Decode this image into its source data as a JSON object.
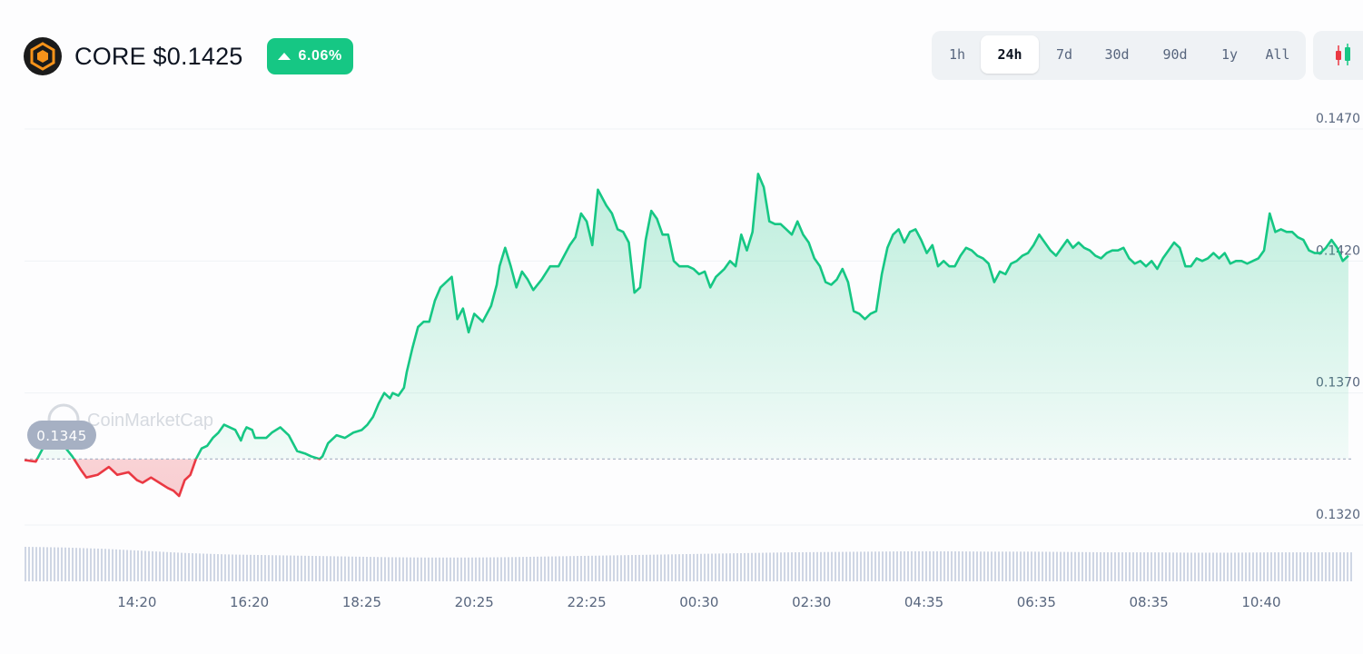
{
  "header": {
    "title": "CORE $0.1425",
    "change_pct": "6.06%",
    "change_direction": "up",
    "logo_icon": "core-logo-icon"
  },
  "range_tabs": [
    {
      "label": "1h",
      "active": false
    },
    {
      "label": "24h",
      "active": true
    },
    {
      "label": "7d",
      "active": false
    },
    {
      "label": "30d",
      "active": false
    },
    {
      "label": "90d",
      "active": false
    },
    {
      "label": "1y",
      "active": false
    },
    {
      "label": "All",
      "active": false
    }
  ],
  "chart_type_toggle_icon": "candlestick-icon",
  "watermark": "CoinMarketCap",
  "colors": {
    "up": "#16c784",
    "down": "#ea3943",
    "accent_logo": "#f7931a",
    "grid": "#eff2f5",
    "volume": "#cfd6e4",
    "open_badge": "#a6b0c3"
  },
  "chart_data": {
    "type": "line",
    "title": "",
    "xlabel": "",
    "ylabel": "",
    "open_price": 0.1345,
    "open_price_label": "0.1345",
    "ylim": [
      0.13045,
      0.14765
    ],
    "y_ticks": [
      {
        "value": 0.132,
        "label": "0.1320"
      },
      {
        "value": 0.137,
        "label": "0.1370"
      },
      {
        "value": 0.142,
        "label": "0.1420"
      },
      {
        "value": 0.147,
        "label": "0.1470"
      }
    ],
    "x_ticks": [
      "14:20",
      "16:20",
      "18:25",
      "20:25",
      "22:25",
      "00:30",
      "02:30",
      "04:35",
      "06:35",
      "08:35",
      "10:40"
    ],
    "x_range": [
      -2.0,
      21.6
    ],
    "x_tick_positions": [
      0,
      2,
      4,
      6,
      8,
      10,
      12,
      14,
      16,
      18,
      20
    ],
    "series": [
      {
        "values": [
          [
            -2.0,
            0.13446
          ],
          [
            -1.8,
            0.1344
          ],
          [
            -1.7,
            0.1348
          ],
          [
            -1.6,
            0.1352
          ],
          [
            -1.45,
            0.1349
          ],
          [
            -1.3,
            0.135
          ],
          [
            -1.15,
            0.1346
          ],
          [
            -1.0,
            0.1341
          ],
          [
            -0.9,
            0.1338
          ],
          [
            -0.7,
            0.1339
          ],
          [
            -0.5,
            0.1342
          ],
          [
            -0.35,
            0.1339
          ],
          [
            -0.15,
            0.134
          ],
          [
            0.0,
            0.1337
          ],
          [
            0.1,
            0.1336
          ],
          [
            0.25,
            0.1338
          ],
          [
            0.4,
            0.1336
          ],
          [
            0.55,
            0.1334
          ],
          [
            0.65,
            0.1333
          ],
          [
            0.75,
            0.1331
          ],
          [
            0.85,
            0.1337
          ],
          [
            0.95,
            0.1339
          ],
          [
            1.05,
            0.1345
          ],
          [
            1.15,
            0.1349
          ],
          [
            1.25,
            0.135
          ],
          [
            1.35,
            0.1353
          ],
          [
            1.45,
            0.1355
          ],
          [
            1.55,
            0.1358
          ],
          [
            1.65,
            0.1357
          ],
          [
            1.75,
            0.1356
          ],
          [
            1.85,
            0.1352
          ],
          [
            1.9,
            0.1355
          ],
          [
            1.95,
            0.1357
          ],
          [
            2.05,
            0.1356
          ],
          [
            2.1,
            0.1353
          ],
          [
            2.2,
            0.1353
          ],
          [
            2.3,
            0.1353
          ],
          [
            2.4,
            0.1355
          ],
          [
            2.55,
            0.1357
          ],
          [
            2.7,
            0.1354
          ],
          [
            2.85,
            0.1348
          ],
          [
            3.0,
            0.1347
          ],
          [
            3.1,
            0.1346
          ],
          [
            3.25,
            0.1345
          ],
          [
            3.3,
            0.1346
          ],
          [
            3.4,
            0.1351
          ],
          [
            3.55,
            0.1354
          ],
          [
            3.7,
            0.1353
          ],
          [
            3.85,
            0.1355
          ],
          [
            4.0,
            0.1356
          ],
          [
            4.1,
            0.1358
          ],
          [
            4.2,
            0.1361
          ],
          [
            4.3,
            0.1366
          ],
          [
            4.4,
            0.137
          ],
          [
            4.5,
            0.1368
          ],
          [
            4.55,
            0.137
          ],
          [
            4.65,
            0.1369
          ],
          [
            4.75,
            0.1372
          ],
          [
            4.8,
            0.1378
          ],
          [
            4.9,
            0.1387
          ],
          [
            5.0,
            0.1395
          ],
          [
            5.1,
            0.1397
          ],
          [
            5.2,
            0.1397
          ],
          [
            5.3,
            0.1405
          ],
          [
            5.4,
            0.141
          ],
          [
            5.5,
            0.1412
          ],
          [
            5.6,
            0.1414
          ],
          [
            5.7,
            0.1398
          ],
          [
            5.8,
            0.1402
          ],
          [
            5.9,
            0.1393
          ],
          [
            6.0,
            0.14
          ],
          [
            6.15,
            0.1397
          ],
          [
            6.3,
            0.1403
          ],
          [
            6.4,
            0.1411
          ],
          [
            6.45,
            0.1418
          ],
          [
            6.55,
            0.1425
          ],
          [
            6.65,
            0.1418
          ],
          [
            6.75,
            0.141
          ],
          [
            6.85,
            0.1416
          ],
          [
            6.95,
            0.1413
          ],
          [
            7.05,
            0.1409
          ],
          [
            7.2,
            0.1413
          ],
          [
            7.35,
            0.1418
          ],
          [
            7.5,
            0.1418
          ],
          [
            7.6,
            0.1422
          ],
          [
            7.7,
            0.1426
          ],
          [
            7.8,
            0.1429
          ],
          [
            7.9,
            0.1438
          ],
          [
            8.0,
            0.1435
          ],
          [
            8.1,
            0.1426
          ],
          [
            8.2,
            0.1447
          ],
          [
            8.35,
            0.1441
          ],
          [
            8.45,
            0.1438
          ],
          [
            8.55,
            0.1432
          ],
          [
            8.65,
            0.1431
          ],
          [
            8.75,
            0.1427
          ],
          [
            8.85,
            0.1408
          ],
          [
            8.95,
            0.141
          ],
          [
            9.05,
            0.1428
          ],
          [
            9.15,
            0.1439
          ],
          [
            9.25,
            0.1436
          ],
          [
            9.35,
            0.143
          ],
          [
            9.45,
            0.143
          ],
          [
            9.55,
            0.142
          ],
          [
            9.65,
            0.1418
          ],
          [
            9.8,
            0.1418
          ],
          [
            9.9,
            0.1417
          ],
          [
            10.0,
            0.1415
          ],
          [
            10.1,
            0.1416
          ],
          [
            10.2,
            0.141
          ],
          [
            10.3,
            0.1414
          ],
          [
            10.45,
            0.1417
          ],
          [
            10.55,
            0.142
          ],
          [
            10.65,
            0.1418
          ],
          [
            10.75,
            0.143
          ],
          [
            10.85,
            0.1424
          ],
          [
            10.95,
            0.1431
          ],
          [
            11.05,
            0.1453
          ],
          [
            11.15,
            0.1448
          ],
          [
            11.25,
            0.1435
          ],
          [
            11.35,
            0.1434
          ],
          [
            11.45,
            0.1434
          ],
          [
            11.55,
            0.1432
          ],
          [
            11.65,
            0.143
          ],
          [
            11.75,
            0.1435
          ],
          [
            11.85,
            0.143
          ],
          [
            11.95,
            0.1427
          ],
          [
            12.05,
            0.1421
          ],
          [
            12.15,
            0.1418
          ],
          [
            12.25,
            0.1412
          ],
          [
            12.35,
            0.1411
          ],
          [
            12.45,
            0.1413
          ],
          [
            12.55,
            0.1417
          ],
          [
            12.65,
            0.1412
          ],
          [
            12.75,
            0.1401
          ],
          [
            12.85,
            0.14
          ],
          [
            12.95,
            0.1398
          ],
          [
            13.05,
            0.14
          ],
          [
            13.15,
            0.1401
          ],
          [
            13.25,
            0.1415
          ],
          [
            13.35,
            0.1425
          ],
          [
            13.45,
            0.143
          ],
          [
            13.55,
            0.1432
          ],
          [
            13.65,
            0.1427
          ],
          [
            13.75,
            0.1431
          ],
          [
            13.85,
            0.1432
          ],
          [
            13.95,
            0.1428
          ],
          [
            14.05,
            0.1423
          ],
          [
            14.15,
            0.1426
          ],
          [
            14.25,
            0.1418
          ],
          [
            14.35,
            0.142
          ],
          [
            14.45,
            0.1418
          ],
          [
            14.55,
            0.1418
          ],
          [
            14.65,
            0.1422
          ],
          [
            14.75,
            0.1425
          ],
          [
            14.85,
            0.1424
          ],
          [
            14.95,
            0.1422
          ],
          [
            15.05,
            0.1421
          ],
          [
            15.15,
            0.1419
          ],
          [
            15.25,
            0.1412
          ],
          [
            15.35,
            0.1416
          ],
          [
            15.45,
            0.1415
          ],
          [
            15.55,
            0.1419
          ],
          [
            15.65,
            0.142
          ],
          [
            15.75,
            0.1422
          ],
          [
            15.85,
            0.1423
          ],
          [
            15.95,
            0.1426
          ],
          [
            16.05,
            0.143
          ],
          [
            16.15,
            0.1427
          ],
          [
            16.25,
            0.1424
          ],
          [
            16.35,
            0.1422
          ],
          [
            16.45,
            0.1425
          ],
          [
            16.55,
            0.1428
          ],
          [
            16.65,
            0.1425
          ],
          [
            16.75,
            0.1427
          ],
          [
            16.85,
            0.1425
          ],
          [
            16.95,
            0.1424
          ],
          [
            17.05,
            0.1422
          ],
          [
            17.15,
            0.1421
          ],
          [
            17.25,
            0.1423
          ],
          [
            17.35,
            0.1424
          ],
          [
            17.45,
            0.1424
          ],
          [
            17.55,
            0.1425
          ],
          [
            17.65,
            0.1421
          ],
          [
            17.75,
            0.1419
          ],
          [
            17.85,
            0.142
          ],
          [
            17.95,
            0.1418
          ],
          [
            18.05,
            0.142
          ],
          [
            18.15,
            0.1417
          ],
          [
            18.25,
            0.1421
          ],
          [
            18.35,
            0.1424
          ],
          [
            18.45,
            0.1427
          ],
          [
            18.55,
            0.1425
          ],
          [
            18.65,
            0.1418
          ],
          [
            18.75,
            0.1418
          ],
          [
            18.85,
            0.1421
          ],
          [
            18.95,
            0.142
          ],
          [
            19.05,
            0.1421
          ],
          [
            19.15,
            0.1423
          ],
          [
            19.25,
            0.1421
          ],
          [
            19.35,
            0.1423
          ],
          [
            19.45,
            0.1419
          ],
          [
            19.55,
            0.142
          ],
          [
            19.65,
            0.142
          ],
          [
            19.75,
            0.1419
          ],
          [
            19.85,
            0.142
          ],
          [
            19.95,
            0.1421
          ],
          [
            20.05,
            0.1424
          ],
          [
            20.15,
            0.1438
          ],
          [
            20.25,
            0.1431
          ],
          [
            20.35,
            0.1432
          ],
          [
            20.45,
            0.1431
          ],
          [
            20.55,
            0.1431
          ],
          [
            20.65,
            0.1429
          ],
          [
            20.75,
            0.1428
          ],
          [
            20.85,
            0.1424
          ],
          [
            20.95,
            0.1423
          ],
          [
            21.05,
            0.1423
          ],
          [
            21.15,
            0.1425
          ],
          [
            21.25,
            0.1428
          ],
          [
            21.35,
            0.1425
          ],
          [
            21.45,
            0.142
          ],
          [
            21.55,
            0.1422
          ]
        ]
      }
    ],
    "volume": {
      "x_range": [
        -2.0,
        21.6
      ],
      "values": [
        1.0,
        0.98,
        0.94,
        0.88,
        0.82,
        0.78,
        0.76,
        0.74,
        0.72,
        0.7,
        0.69,
        0.69,
        0.7,
        0.72,
        0.74,
        0.76,
        0.78,
        0.8,
        0.82,
        0.84,
        0.85,
        0.86,
        0.87,
        0.87,
        0.86,
        0.86,
        0.85,
        0.84,
        0.84,
        0.83,
        0.83,
        0.84,
        0.84,
        0.84
      ]
    },
    "grid": true,
    "legend": "none"
  }
}
